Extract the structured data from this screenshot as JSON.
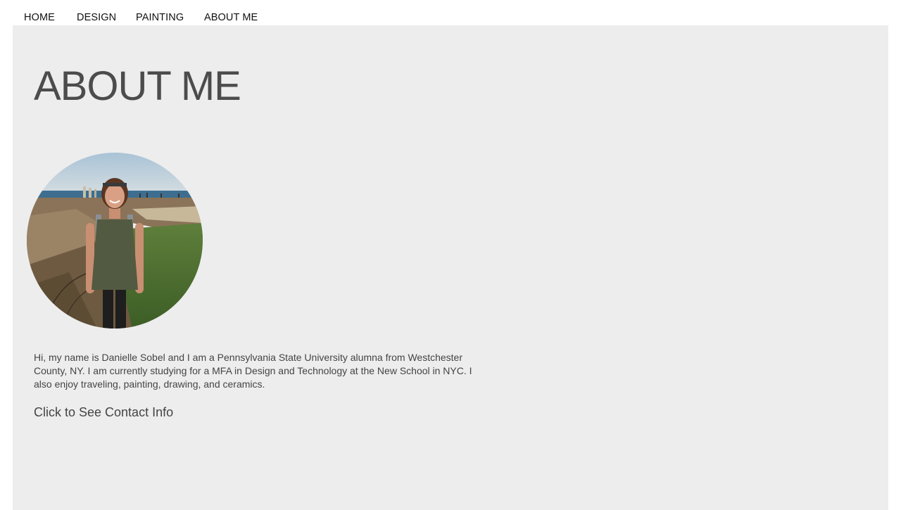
{
  "nav": {
    "items": [
      {
        "label": "HOME"
      },
      {
        "label": "DESIGN"
      },
      {
        "label": "PAINTING"
      },
      {
        "label": "ABOUT ME"
      }
    ]
  },
  "main": {
    "title": "ABOUT ME",
    "bio": "Hi, my name is Danielle Sobel and I am a Pennsylvania State University alumna from Westchester County, NY. I am currently studying for a MFA in Design and Technology at the New School in NYC. I also enjoy traveling, painting, drawing, and ceramics.",
    "contact_link": "Click to See Contact Info"
  },
  "colors": {
    "panel_background": "#ededed",
    "title_text": "#4c4c4c",
    "body_text": "#444444",
    "nav_text": "#111111"
  }
}
